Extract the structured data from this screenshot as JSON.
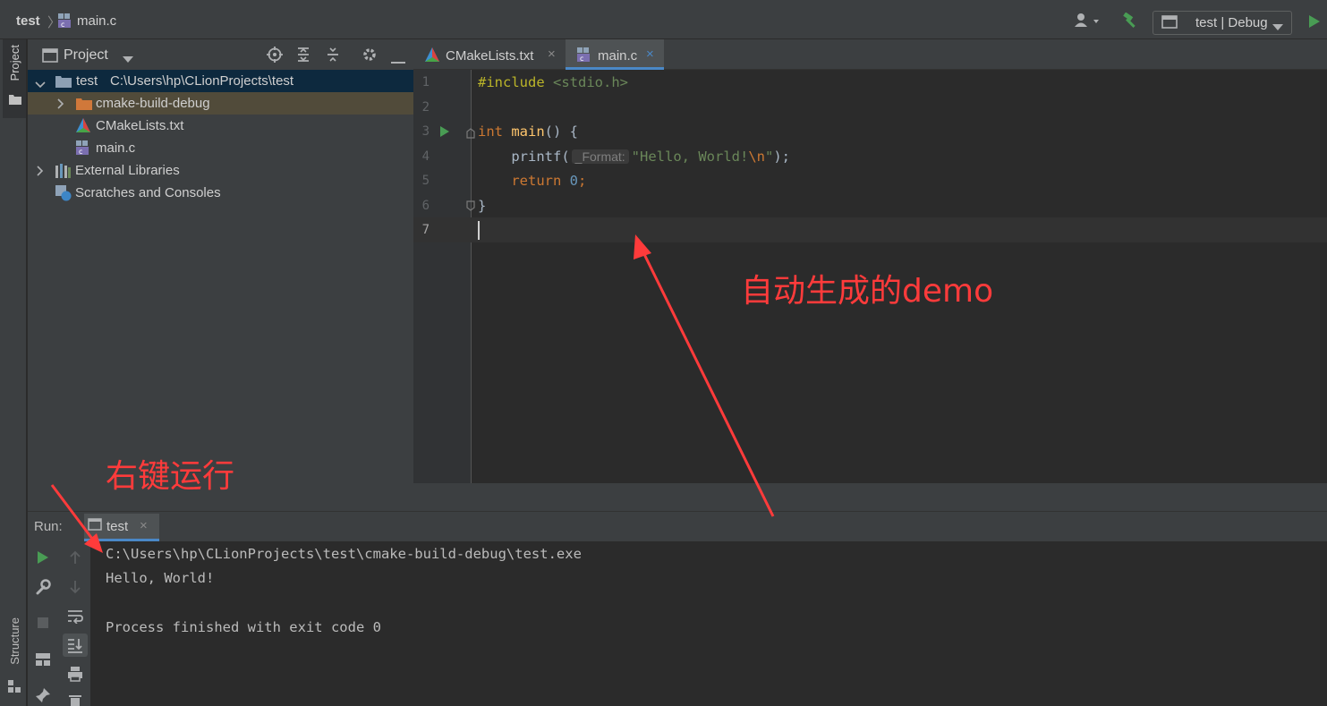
{
  "navbar": {
    "project_name": "test",
    "separator": "〉",
    "file_name": "main.c",
    "run_config": "test | Debug"
  },
  "left_strip": {
    "project_tab": "Project",
    "structure_tab": "Structure"
  },
  "project_panel": {
    "title": "Project",
    "tree": {
      "root_name": "test",
      "root_path": "C:\\Users\\hp\\CLionProjects\\test",
      "build_folder": "cmake-build-debug",
      "cmake_file": "CMakeLists.txt",
      "main_file": "main.c",
      "external_libraries": "External Libraries",
      "scratches": "Scratches and Consoles"
    }
  },
  "editor_tabs": {
    "tab1": "CMakeLists.txt",
    "tab2": "main.c",
    "close": "×"
  },
  "editor": {
    "line_numbers": [
      "1",
      "2",
      "3",
      "4",
      "5",
      "6",
      "7"
    ],
    "line1_directive": "#include",
    "line1_header": "<stdio.h>",
    "line3_type": "int",
    "line3_fn": "main",
    "line3_rest": "() {",
    "line4_call": "printf(",
    "line4_hint": "_Format:",
    "line4_str": "\"Hello, World!",
    "line4_esc": "\\n",
    "line4_end_quote": "\"",
    "line4_end": ");",
    "line5_kw": "return",
    "line5_num": "0",
    "line5_end": ";",
    "line6": "}"
  },
  "run_panel": {
    "label": "Run:",
    "tab_name": "test",
    "tab_close": "×",
    "console": {
      "line1": "C:\\Users\\hp\\CLionProjects\\test\\cmake-build-debug\\test.exe",
      "line2": "Hello, World!",
      "line3": "Process finished with exit code 0"
    }
  },
  "annotations": {
    "demo": "自动生成的demo",
    "run": "右键运行",
    "color": "#ff3b3b"
  },
  "colors": {
    "accent": "#4a88c7",
    "run_green": "#499c54",
    "keyword": "#cc7832",
    "string": "#6a8759",
    "number": "#6897bb",
    "function": "#ffc66d"
  }
}
